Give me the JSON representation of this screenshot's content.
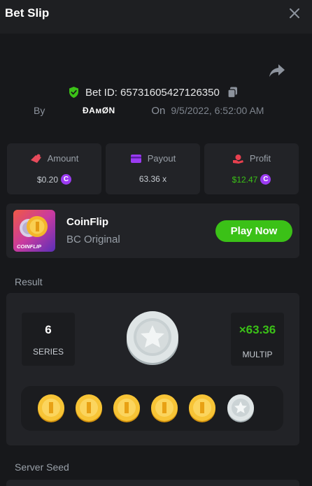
{
  "header": {
    "title": "Bet Slip"
  },
  "bet": {
    "id_text": "Bet ID: 65731605427126350",
    "by_label": "By",
    "user": "ĐΑмØΝ",
    "on_label": "On",
    "date": "9/5/2022, 6:52:00 AM"
  },
  "stats": {
    "amount": {
      "label": "Amount",
      "value": "$0.20"
    },
    "payout": {
      "label": "Payout",
      "value": "63.36 x"
    },
    "profit": {
      "label": "Profit",
      "value": "$12.47"
    },
    "currency_symbol": "C"
  },
  "game": {
    "name": "CoinFlip",
    "subtitle": "BC Original",
    "thumb_text": "COINFLIP",
    "play_label": "Play Now"
  },
  "result": {
    "section_label": "Result",
    "series_value": "6",
    "series_label": "SERIES",
    "multiplier_value": "×63.36",
    "multiplier_label": "MULTIP",
    "flips": [
      "gold",
      "gold",
      "gold",
      "gold",
      "gold",
      "silver"
    ]
  },
  "server_seed": {
    "label": "Server Seed"
  },
  "colors": {
    "accent_green": "#3bc117",
    "currency_purple": "#9b3bf2",
    "gold_coin": "#f2b628",
    "silver_coin": "#cfd6d8"
  }
}
